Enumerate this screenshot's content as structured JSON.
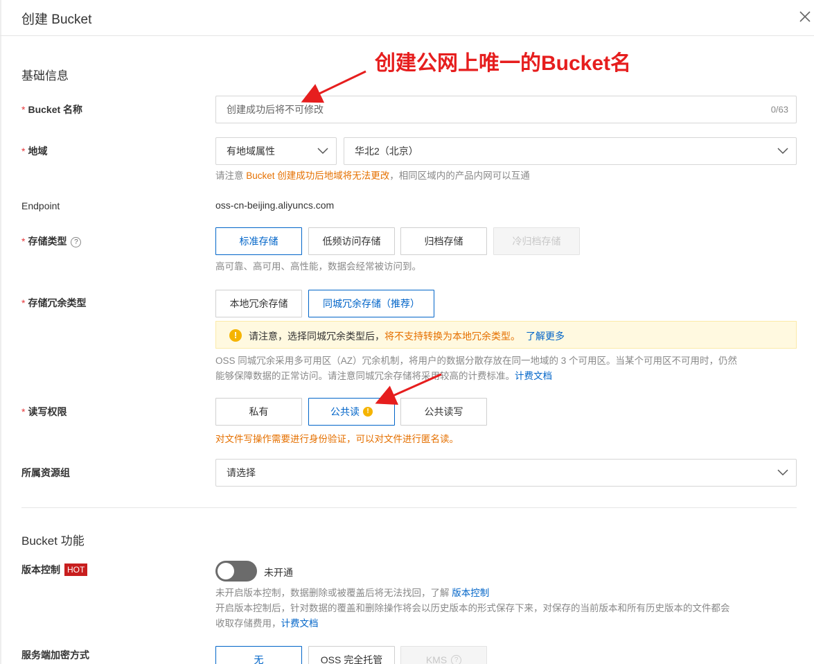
{
  "header": {
    "title": "创建 Bucket"
  },
  "annotation": {
    "text": "创建公网上唯一的Bucket名"
  },
  "basic": {
    "section_title": "基础信息",
    "bucket_name": {
      "label": "Bucket 名称",
      "placeholder": "创建成功后将不可修改",
      "counter": "0/63"
    },
    "region": {
      "label": "地域",
      "attr_select": "有地域属性",
      "region_select": "华北2（北京）",
      "help_prefix": "请注意 ",
      "help_warn": "Bucket 创建成功后地域将无法更改",
      "help_suffix": "，相同区域内的产品内网可以互通"
    },
    "endpoint": {
      "label": "Endpoint",
      "value": "oss-cn-beijing.aliyuncs.com"
    },
    "storage_class": {
      "label": "存储类型",
      "options": [
        "标准存储",
        "低频访问存储",
        "归档存储",
        "冷归档存储"
      ],
      "help": "高可靠、高可用、高性能，数据会经常被访问到。"
    },
    "redundancy": {
      "label": "存储冗余类型",
      "options": [
        "本地冗余存储",
        "同城冗余存储（推荐）"
      ],
      "notice_prefix": "请注意，选择同城冗余类型后，",
      "notice_warn": "将不支持转换为本地冗余类型。",
      "notice_link": "了解更多",
      "help_line1": "OSS 同城冗余采用多可用区（AZ）冗余机制，将用户的数据分散存放在同一地域的 3 个可用区。当某个可用区不可用时，仍然",
      "help_line2": "能够保障数据的正常访问。请注意同城冗余存储将采用较高的计费标准。",
      "help_link": "计费文档"
    },
    "acl": {
      "label": "读写权限",
      "options": [
        "私有",
        "公共读",
        "公共读写"
      ],
      "warning": "对文件写操作需要进行身份验证，可以对文件进行匿名读。"
    },
    "resource_group": {
      "label": "所属资源组",
      "placeholder": "请选择"
    }
  },
  "features": {
    "section_title": "Bucket 功能",
    "versioning": {
      "label": "版本控制",
      "badge": "HOT",
      "toggle_label": "未开通",
      "help_line1": "未开启版本控制，数据删除或被覆盖后将无法找回，了解 ",
      "help_link1": "版本控制",
      "help_line2": "开启版本控制后，针对数据的覆盖和删除操作将会以历史版本的形式保存下来，对保存的当前版本和所有历史版本的文件都会",
      "help_line3": "收取存储费用，",
      "help_link2": "计费文档"
    },
    "encryption": {
      "label": "服务端加密方式",
      "options": [
        "无",
        "OSS 完全托管",
        "KMS"
      ]
    }
  },
  "colors": {
    "primary": "#0064c8",
    "warning": "#e57000",
    "annotation": "#e61e1e"
  }
}
